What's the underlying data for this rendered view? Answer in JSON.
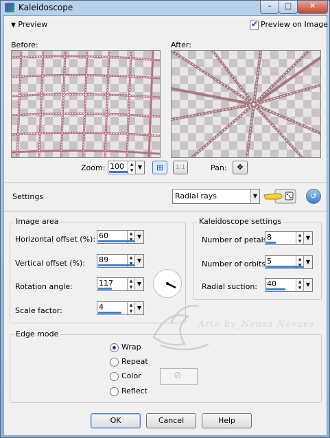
{
  "window": {
    "title": "Kaleidoscope",
    "minimize": "–",
    "maximize": "□",
    "close": "✕"
  },
  "preview": {
    "section_label": "Preview",
    "preview_on_image_label": "Preview on Image",
    "preview_on_image_checked": true,
    "before_label": "Before:",
    "after_label": "After:",
    "zoom_label": "Zoom:",
    "zoom_value": "100",
    "zoom_fit_label": "1:1",
    "pan_label": "Pan:"
  },
  "settings": {
    "label": "Settings",
    "preset_value": "Radial rays"
  },
  "image_area": {
    "title": "Image area",
    "fields": [
      {
        "label": "Horizontal offset (%):",
        "value": "60"
      },
      {
        "label": "Vertical offset (%):",
        "value": "89"
      },
      {
        "label": "Rotation angle:",
        "value": "117"
      },
      {
        "label": "Scale factor:",
        "value": "4"
      }
    ]
  },
  "kaleidoscope_settings": {
    "title": "Kaleidoscope settings",
    "fields": [
      {
        "label": "Number of petals:",
        "value": "8"
      },
      {
        "label": "Number of orbits:",
        "value": "5"
      },
      {
        "label": "Radial suction:",
        "value": "40"
      }
    ]
  },
  "edge_mode": {
    "title": "Edge mode",
    "options": [
      "Wrap",
      "Repeat",
      "Color",
      "Reflect"
    ],
    "selected": "Wrap"
  },
  "watermark_text": "Arte by_Neusa Novaes",
  "buttons": {
    "ok": "OK",
    "cancel": "Cancel",
    "help": "Help"
  },
  "colors": {
    "title_gradient_top": "#b9d1ea",
    "accent_blue": "#3c7fd6",
    "face": "#f0f0f0"
  }
}
